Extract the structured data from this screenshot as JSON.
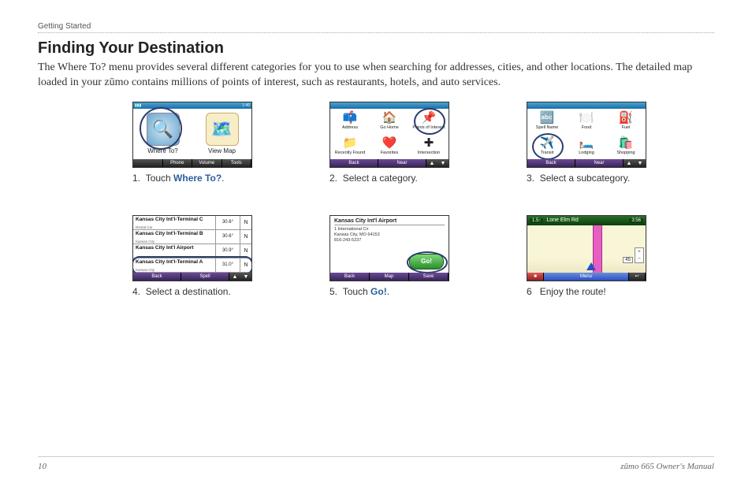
{
  "header": {
    "section": "Getting Started"
  },
  "title": "Finding Your Destination",
  "intro": "The Where To? menu provides several different categories for you to use when searching for addresses, cities, and other locations. The detailed map loaded in your zūmo contains millions of points of interest, such as restaurants, hotels, and auto services.",
  "steps": [
    {
      "num": "1.",
      "text": "Touch ",
      "bold": "Where To?",
      "after": "."
    },
    {
      "num": "2.",
      "text": "Select a category."
    },
    {
      "num": "3.",
      "text": "Select a subcategory."
    },
    {
      "num": "4.",
      "text": "Select a destination."
    },
    {
      "num": "5.",
      "text": "Touch ",
      "bold": "Go!",
      "after": "."
    },
    {
      "num": "6",
      "text": "Enjoy the route!"
    }
  ],
  "shot1": {
    "clock": "1:46",
    "buttons": [
      {
        "label": "Where To?",
        "icon": "🔍"
      },
      {
        "label": "View Map",
        "icon": "🗺️"
      }
    ],
    "bottom": [
      "",
      "Phone",
      "Volume",
      "Tools"
    ]
  },
  "shot2": {
    "cells": [
      {
        "label": "Address",
        "icon": "📫"
      },
      {
        "label": "Go Home",
        "icon": "🏠"
      },
      {
        "label": "Points of Interest",
        "icon": "📌"
      },
      {
        "label": "Recently Found",
        "icon": "📁"
      },
      {
        "label": "Favorites",
        "icon": "❤️"
      },
      {
        "label": "Intersection",
        "icon": "✚"
      }
    ],
    "nav": {
      "back": "Back",
      "near": "Near"
    }
  },
  "shot3": {
    "cells": [
      {
        "label": "Spell Name",
        "icon": "🔤"
      },
      {
        "label": "Food",
        "icon": "🍽️"
      },
      {
        "label": "Fuel",
        "icon": "⛽"
      },
      {
        "label": "Transit",
        "icon": "✈️"
      },
      {
        "label": "Lodging",
        "icon": "🛏️"
      },
      {
        "label": "Shopping",
        "icon": "🛍️"
      }
    ],
    "nav": {
      "back": "Back",
      "near": "Near"
    }
  },
  "shot4": {
    "rows": [
      {
        "name": "Kansas City Int'l-Terminal C",
        "sub": "Rental Car",
        "dist": "30.6°",
        "dir": "N"
      },
      {
        "name": "Kansas City Int'l-Terminal B",
        "sub": "Kansas City",
        "dist": "30.6°",
        "dir": "N"
      },
      {
        "name": "Kansas City Int'l Airport",
        "sub": "",
        "dist": "30.9°",
        "dir": "N"
      },
      {
        "name": "Kansas City Int'l-Terminal A",
        "sub": "Kansas City",
        "dist": "31.0°",
        "dir": "N"
      }
    ],
    "nav": {
      "back": "Back",
      "spell": "Spell"
    }
  },
  "shot5": {
    "title": "Kansas City Int'l Airport",
    "addr": [
      "1 International Cir",
      "Kansas City, MO 64153",
      "816-243-5237"
    ],
    "go": "Go!",
    "nav": {
      "back": "Back",
      "map": "Map",
      "save": "Save"
    }
  },
  "shot6": {
    "dist": "1.5↑",
    "road": "Lone Elm Rd",
    "eta": "3:56",
    "speed": "45",
    "menu": "Menu"
  },
  "footer": {
    "page": "10",
    "manual": "zūmo 665 Owner's Manual"
  }
}
